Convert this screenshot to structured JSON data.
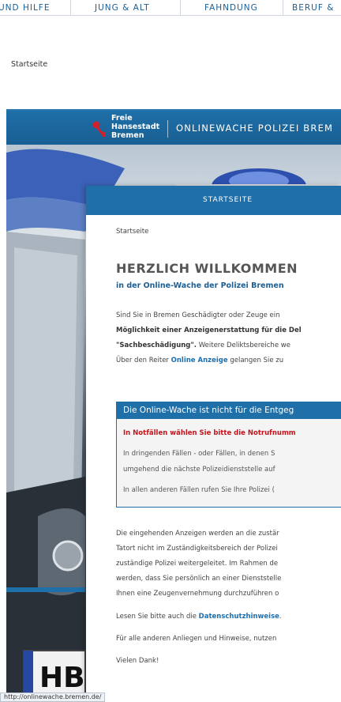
{
  "top_nav": {
    "tabs": [
      "UND HILFE",
      "JUNG & ALT",
      "FAHNDUNG",
      "BERUF &"
    ]
  },
  "outer_breadcrumb": "Startseite",
  "site": {
    "logo_line1": "Freie",
    "logo_line2": "Hansestadt",
    "logo_line3": "Bremen",
    "header_title": "ONLINEWACHE POLIZEI BREM",
    "nav_label": "STARTSEITE"
  },
  "content": {
    "breadcrumb": "Startseite",
    "title": "HERZLICH WILLKOMMEN",
    "subtitle": "in der Online-Wache der Polizei Bremen",
    "intro": {
      "line1": "Sind Sie in Bremen Geschädigter oder Zeuge ein",
      "line2": "Möglichkeit einer Anzeigenerstattung für die Del",
      "line3_bold": "\"Sachbeschädigung\".",
      "line3_rest": " Weitere Deliktsbereiche we",
      "line4_pre": "Über den Reiter ",
      "line4_link": "Online Anzeige",
      "line4_post": " gelangen Sie zu"
    },
    "notice": {
      "heading": "Die Online-Wache ist nicht für die Entgeg",
      "emergency": "In Notfällen wählen Sie bitte die Notrufnumm",
      "line1": "In dringenden Fällen - oder Fällen, in denen S",
      "line2": "umgehend die nächste Polizeidienststelle auf",
      "line3": "In allen anderen Fällen rufen Sie Ihre Polizei ("
    },
    "body": {
      "line1": "Die eingehenden Anzeigen werden an die zustär",
      "line2": "Tatort nicht im Zuständigkeitsbereich der Polizei",
      "line3": "zuständige Polizei weitergeleitet. Im Rahmen de",
      "line4": "werden, dass Sie persönlich an einer Dienststelle",
      "line5": "Ihnen eine Zeugenvernehmung durchzuführen o"
    },
    "privacy_pre": "Lesen Sie bitte auch die ",
    "privacy_link": "Datenschutzhinweise",
    "privacy_post": ".",
    "other": "Für alle anderen Anliegen und Hinweise, nutzen",
    "thanks": "Vielen Dank!"
  },
  "status_url": "http://onlinewache.bremen.de/",
  "colors": {
    "brand_blue": "#1f6fa8",
    "link_blue": "#1b6fb0",
    "alert_red": "#c3141b"
  }
}
